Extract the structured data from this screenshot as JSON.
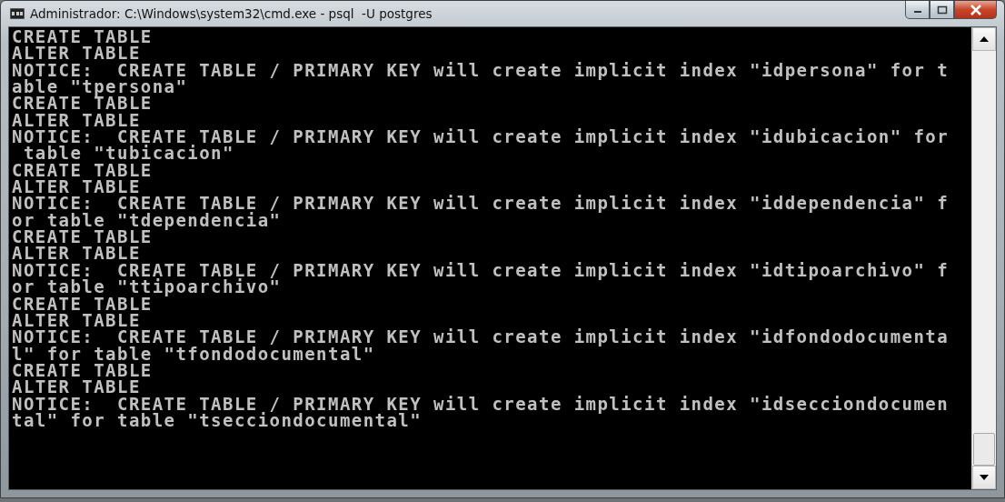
{
  "window": {
    "title": "Administrador: C:\\Windows\\system32\\cmd.exe - psql  -U postgres"
  },
  "console": {
    "lines": [
      "CREATE TABLE",
      "ALTER TABLE",
      "NOTICE:  CREATE TABLE / PRIMARY KEY will create implicit index \"idpersona\" for t",
      "able \"tpersona\"",
      "CREATE TABLE",
      "ALTER TABLE",
      "NOTICE:  CREATE TABLE / PRIMARY KEY will create implicit index \"idubicacion\" for",
      " table \"tubicacion\"",
      "CREATE TABLE",
      "ALTER TABLE",
      "NOTICE:  CREATE TABLE / PRIMARY KEY will create implicit index \"iddependencia\" f",
      "or table \"tdependencia\"",
      "CREATE TABLE",
      "ALTER TABLE",
      "NOTICE:  CREATE TABLE / PRIMARY KEY will create implicit index \"idtipoarchivo\" f",
      "or table \"ttipoarchivo\"",
      "CREATE TABLE",
      "ALTER TABLE",
      "NOTICE:  CREATE TABLE / PRIMARY KEY will create implicit index \"idfondodocumenta",
      "l\" for table \"tfondodocumental\"",
      "CREATE TABLE",
      "ALTER TABLE",
      "NOTICE:  CREATE TABLE / PRIMARY KEY will create implicit index \"idsecciondocumen",
      "tal\" for table \"tsecciondocumental\""
    ]
  }
}
